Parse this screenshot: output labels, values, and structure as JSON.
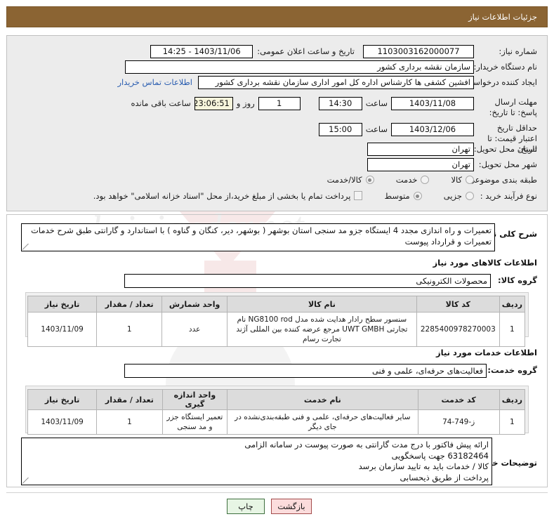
{
  "header": {
    "title": "جزئیات اطلاعات نیاز"
  },
  "watermark": {
    "text": "hriajander.net"
  },
  "form": {
    "need_number": {
      "label": "شماره نیاز:",
      "value": "1103003162000077"
    },
    "announce_datetime": {
      "label": "تاریخ و ساعت اعلان عمومی:",
      "value": "1403/11/06 - 14:25"
    },
    "buyer_org": {
      "label": "نام دستگاه خریدار:",
      "value": "سازمان نقشه برداری کشور"
    },
    "requester": {
      "label": "ایجاد کننده درخواست:",
      "value": "افشین کشفی ها کارشناس اداره کل امور اداری سازمان نقشه برداری کشور",
      "contact_link": "اطلاعات تماس خریدار"
    },
    "response_deadline": {
      "label": "مهلت ارسال پاسخ: تا تاریخ:",
      "date": "1403/11/08",
      "time_label": "ساعت",
      "time": "14:30",
      "days": "1",
      "days_sep": "روز و",
      "countdown": "23:06:51",
      "countdown_suffix": "ساعت باقی مانده"
    },
    "price_validity": {
      "label": "حداقل تاریخ اعتبار قیمت: تا تاریخ:",
      "date": "1403/12/06",
      "time_label": "ساعت",
      "time": "15:00"
    },
    "delivery_province": {
      "label": "استان محل تحویل:",
      "value": "تهران"
    },
    "delivery_city": {
      "label": "شهر محل تحویل:",
      "value": "تهران"
    },
    "subject_class": {
      "label": "طبقه بندی موضوعی:",
      "options": [
        {
          "text": "کالا",
          "selected": false
        },
        {
          "text": "خدمت",
          "selected": false
        },
        {
          "text": "کالا/خدمت",
          "selected": true
        }
      ]
    },
    "purchase_process": {
      "label": "نوع فرآیند خرید :",
      "options": [
        {
          "text": "جزیی",
          "selected": false
        },
        {
          "text": "متوسط",
          "selected": true
        }
      ],
      "checkbox_label": "پرداخت تمام یا بخشی از مبلغ خرید،از محل \"اسناد خزانه اسلامی\" خواهد بود.",
      "checkbox_checked": false
    }
  },
  "need_description": {
    "label": "شرح کلی نیاز:",
    "value": "تعمیرات و راه اندازی مجدد 4 ایستگاه جزو مد سنجی استان بوشهر ( بوشهر، دیر، کنگان و گناوه ) با استاندارد و گارانتی طبق شرح خدمات تعمیرات و قرارداد پیوست"
  },
  "goods_section": {
    "heading": "اطلاعات کالاهای مورد نیاز",
    "group_label": "گروه کالا:",
    "group_value": "محصولات الکترونیکی",
    "columns": [
      "ردیف",
      "کد کالا",
      "نام کالا",
      "واحد شمارش",
      "تعداد / مقدار",
      "تاریخ نیاز"
    ],
    "rows": [
      {
        "index": "1",
        "code": "2285400978270003",
        "name": "سنسور سطح رادار هدایت شده مدل NG8100 rod نام تجارتی UWT GMBH مرجع عرضه کننده بین المللی آژند تجارت رسام",
        "unit": "عدد",
        "qty": "1",
        "date": "1403/11/09"
      }
    ]
  },
  "services_section": {
    "heading": "اطلاعات خدمات مورد نیاز",
    "group_label": "گروه خدمت:",
    "group_value": "فعالیت‌های حرفه‌ای، علمی و فنی",
    "columns": [
      "ردیف",
      "کد خدمت",
      "نام خدمت",
      "واحد اندازه گیری",
      "تعداد / مقدار",
      "تاریخ نیاز"
    ],
    "rows": [
      {
        "index": "1",
        "code": "ز-749-74",
        "name": "سایر فعالیت‌های حرفه‌ای، علمی و فنی طبقه‌بندی‌نشده در جای دیگر",
        "unit": "تعمیر ایستگاه جزر و مد سنجی",
        "qty": "1",
        "date": "1403/11/09"
      }
    ]
  },
  "buyer_notes": {
    "label": "توضیحات خریدار:",
    "lines": [
      "ارائه پیش فاکتور با درج مدت گارانتی به صورت پیوست در سامانه الزامی",
      "63182464 جهت پاسخگویی",
      "کالا / خدمات باید به تایید سازمان برسد",
      "پرداخت از طریق ذیحسابی"
    ]
  },
  "footer": {
    "print_button": "چاپ",
    "back_button": "بازگشت"
  },
  "colors": {
    "titlebar": "#8b6433",
    "link": "#2a5db0",
    "print_border": "#3f6f3f",
    "back_border": "#a34b4b"
  }
}
